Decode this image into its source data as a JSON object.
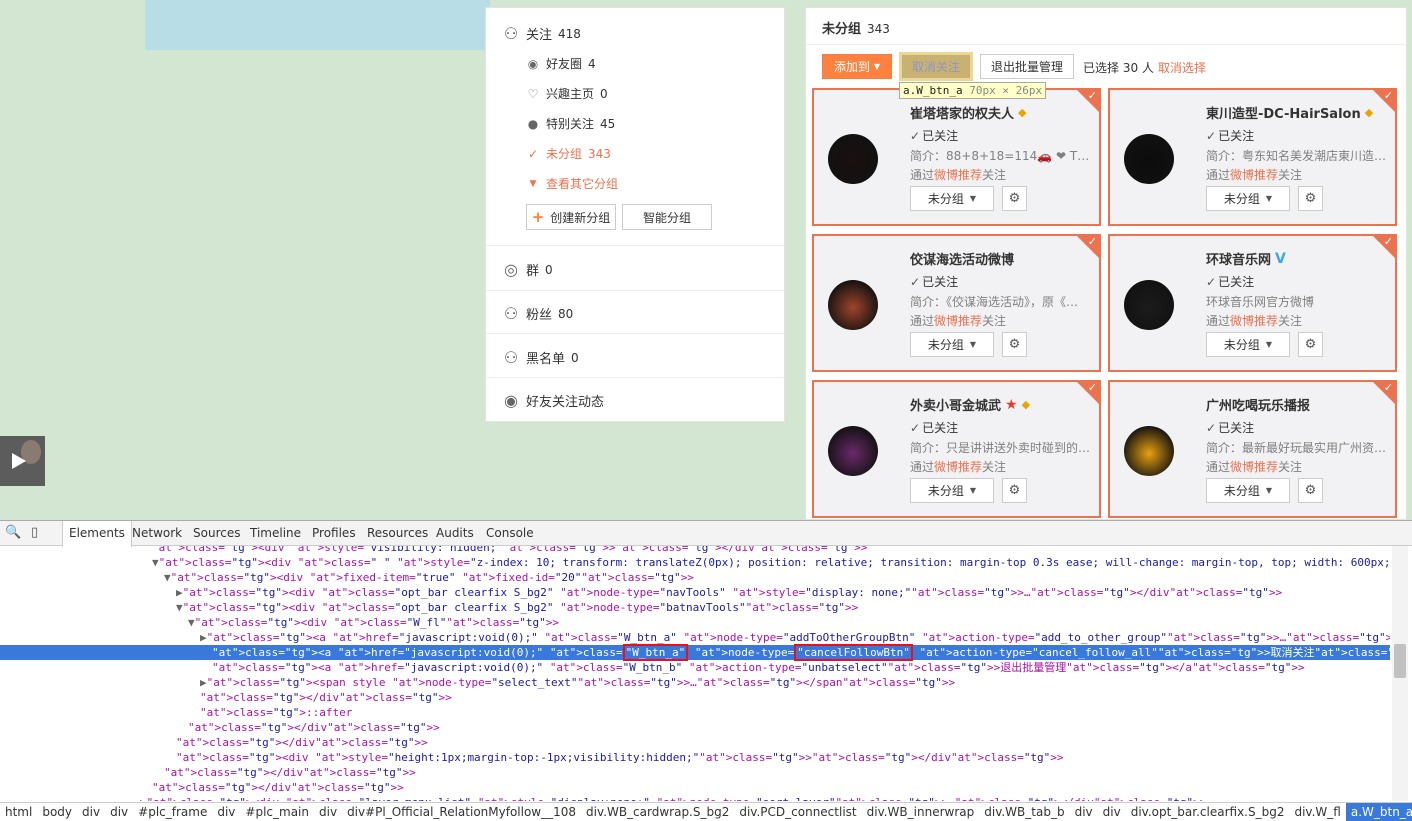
{
  "left": {
    "follow": {
      "label": "关注",
      "count": "418"
    },
    "friends_circle": {
      "label": "好友圈",
      "count": "4"
    },
    "interest_home": {
      "label": "兴趣主页",
      "count": "0"
    },
    "special_follow": {
      "label": "特别关注",
      "count": "45"
    },
    "ungrouped": {
      "label": "未分组",
      "count": "343"
    },
    "view_other": {
      "label": "查看其它分组"
    },
    "create_group": "创建新分组",
    "smart_group": "智能分组",
    "groups": {
      "label": "群",
      "count": "0"
    },
    "fans": {
      "label": "粉丝",
      "count": "80"
    },
    "blacklist": {
      "label": "黑名单",
      "count": "0"
    },
    "friend_activity": {
      "label": "好友关注动态"
    }
  },
  "right": {
    "title": "未分组",
    "count": "343",
    "toolbar": {
      "add_to": "添加到",
      "cancel_follow": "取消关注",
      "exit_batch": "退出批量管理",
      "selected_text": "已选择 30 人",
      "cancel_select": "取消选择"
    },
    "tooltip": {
      "selector": "a.W_btn_a",
      "size": "70px × 26px"
    },
    "cards": [
      {
        "name": "崔塔塔家的权夫人",
        "badge": "vip",
        "followed": "已关注",
        "intro": "简介：88+8+18=114🚗 ❤ The be…",
        "via_prefix": "通过",
        "via_link": "微博推荐",
        "via_suffix": "关注",
        "group": "未分组",
        "avatar_color": "#1a1010"
      },
      {
        "name": "東川造型-DC-HairSalon",
        "badge": "vip",
        "followed": "已关注",
        "intro": "简介：粤东知名美发潮店東川造型…",
        "via_prefix": "通过",
        "via_link": "微博推荐",
        "via_suffix": "关注",
        "group": "未分组",
        "avatar_color": "#0c0c0c"
      },
      {
        "name": "佼谋海选活动微博",
        "badge": "",
        "followed": "已关注",
        "intro": "简介：《佼谋海选活动》，原《…",
        "via_prefix": "通过",
        "via_link": "微博推荐",
        "via_suffix": "关注",
        "group": "未分组",
        "avatar_color": "#a0442a"
      },
      {
        "name": "环球音乐网",
        "badge": "v",
        "followed": "已关注",
        "intro": "环球音乐网官方微博",
        "via_prefix": "通过",
        "via_link": "微博推荐",
        "via_suffix": "关注",
        "group": "未分组",
        "avatar_color": "#1c1c1c"
      },
      {
        "name": "外卖小哥金城武",
        "badge": "star",
        "followed": "已关注",
        "intro": "简介：只是讲讲送外卖时碰到的…",
        "via_prefix": "通过",
        "via_link": "微博推荐",
        "via_suffix": "关注",
        "group": "未分组",
        "avatar_color": "#6a2a6a"
      },
      {
        "name": "广州吃喝玩乐播报",
        "badge": "",
        "followed": "已关注",
        "intro": "简介：最新最好玩最实用广州资讯~",
        "via_prefix": "通过",
        "via_link": "微博推荐",
        "via_suffix": "关注",
        "group": "未分组",
        "avatar_color": "#e8a010"
      }
    ]
  },
  "devtools": {
    "tabs": [
      "Elements",
      "Network",
      "Sources",
      "Timeline",
      "Profiles",
      "Resources",
      "Audits",
      "Console"
    ],
    "lines": [
      "<div style=\"visibility: hidden;\"></div>",
      "▼<div class=\" \" style=\"z-index: 10; transform: translateZ(0px); position: relative; transition: margin-top 0.3s ease; will-change: margin-top, top; width: 600px;\">",
      "▼<div fixed-item=\"true\" fixed-id=\"20\">",
      "▶<div class=\"opt_bar clearfix S_bg2\" node-type=\"navTools\" style=\"display: none;\">…</div>",
      "▼<div class=\"opt_bar clearfix S_bg2\" node-type=\"batnavTools\">",
      "▼<div class=\"W_fl\">",
      "▶<a href=\"javascript:void(0);\" class=\"W_btn_a\" node-type=\"addToOtherGroupBtn\" action-type=\"add_to_other_group\">…</a>",
      "<a href=\"javascript:void(0);\" class=\"W_btn_a\" node-type=\"cancelFollowBtn\" action-type=\"cancel_follow_all\">取消关注</a>",
      "<a href=\"javascript:void(0);\" class=\"W_btn_b\" action-type=\"unbatselect\">退出批量管理</a>",
      "▶<span style node-type=\"select_text\">…</span>",
      "</div>",
      "::after",
      "</div>",
      "</div>",
      "<div style=\"height:1px;margin-top:-1px;visibility:hidden;\"></div>",
      "</div>",
      "</div>",
      "▶<div class=\"layer_menu_list\" style=\"display:none;\" node-type=\"sort_layer\">…</div>"
    ],
    "breadcrumbs": [
      "html",
      "body",
      "div",
      "div",
      "#plc_frame",
      "div",
      "#plc_main",
      "div",
      "div#Pl_Official_RelationMyfollow__108",
      "div.WB_cardwrap.S_bg2",
      "div.PCD_connectlist",
      "div.WB_innerwrap",
      "div.WB_tab_b",
      "div",
      "div",
      "div.opt_bar.clearfix.S_bg2",
      "div.W_fl",
      "a.W_btn_a"
    ]
  }
}
